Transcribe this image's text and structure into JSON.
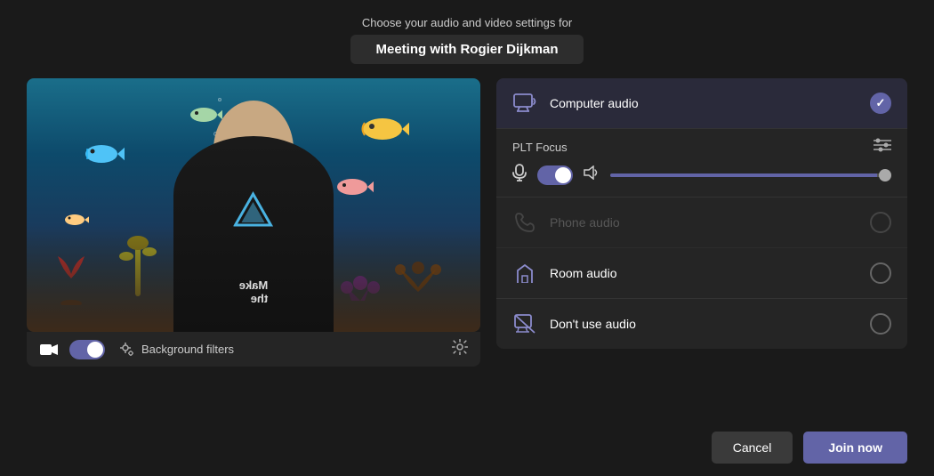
{
  "header": {
    "subtitle": "Choose your audio and video settings for",
    "title": "Meeting with Rogier Dijkman"
  },
  "video_toolbar": {
    "cam_toggle_on": true,
    "bg_filters_label": "Background filters"
  },
  "audio_panel": {
    "options": [
      {
        "id": "computer",
        "label": "Computer audio",
        "icon": "🖥",
        "selected": true,
        "disabled": false
      },
      {
        "id": "phone",
        "label": "Phone audio",
        "icon": "📞",
        "selected": false,
        "disabled": true
      },
      {
        "id": "room",
        "label": "Room audio",
        "icon": "🔔",
        "selected": false,
        "disabled": false
      },
      {
        "id": "none",
        "label": "Don't use audio",
        "icon": "🔇",
        "selected": false,
        "disabled": false
      }
    ],
    "plt_focus_label": "PLT Focus",
    "mic_on": true,
    "volume_percent": 95
  },
  "footer": {
    "cancel_label": "Cancel",
    "join_label": "Join now"
  }
}
